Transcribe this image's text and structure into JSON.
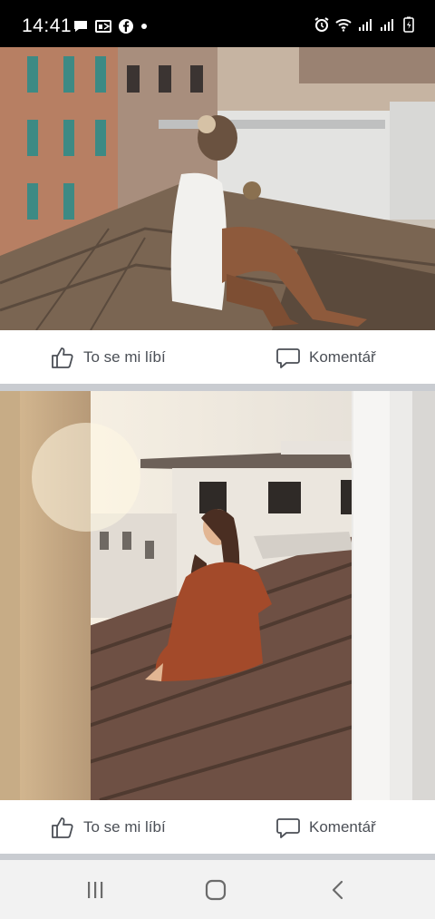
{
  "status_bar": {
    "time": "14:41",
    "left_icons": [
      "chat-icon",
      "outlook-icon",
      "facebook-icon",
      "dot-icon"
    ],
    "right_icons": [
      "alarm-icon",
      "wifi-icon",
      "signal-icon",
      "signal-icon",
      "battery-charging-icon"
    ]
  },
  "posts": [
    {
      "photo_alt": "",
      "like_label": "To se mi líbí",
      "comment_label": "Komentář"
    },
    {
      "photo_alt": "",
      "like_label": "To se mi líbí",
      "comment_label": "Komentář"
    }
  ],
  "nav_bar": {
    "buttons": [
      "recents-icon",
      "home-icon",
      "back-icon"
    ]
  },
  "colors": {
    "action_text": "#4b4f56",
    "feed_background": "#c9ccd1"
  }
}
